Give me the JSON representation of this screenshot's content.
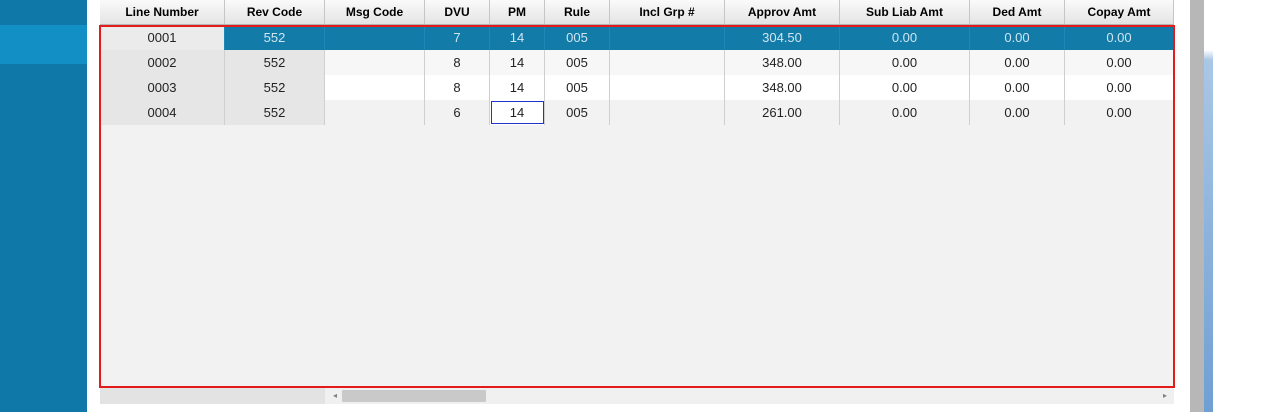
{
  "grid": {
    "columns": [
      "Line Number",
      "Rev Code",
      "Msg Code",
      "DVU",
      "PM",
      "Rule",
      "Incl Grp #",
      "Approv Amt",
      "Sub Liab Amt",
      "Ded Amt",
      "Copay Amt"
    ],
    "rows": [
      {
        "line": "0001",
        "rev": "552",
        "msg": "",
        "dvu": "7",
        "pm": "14",
        "rule": "005",
        "incl": "",
        "approv": "304.50",
        "subliab": "0.00",
        "ded": "0.00",
        "copay": "0.00"
      },
      {
        "line": "0002",
        "rev": "552",
        "msg": "",
        "dvu": "8",
        "pm": "14",
        "rule": "005",
        "incl": "",
        "approv": "348.00",
        "subliab": "0.00",
        "ded": "0.00",
        "copay": "0.00"
      },
      {
        "line": "0003",
        "rev": "552",
        "msg": "",
        "dvu": "8",
        "pm": "14",
        "rule": "005",
        "incl": "",
        "approv": "348.00",
        "subliab": "0.00",
        "ded": "0.00",
        "copay": "0.00"
      },
      {
        "line": "0004",
        "rev": "552",
        "msg": "",
        "dvu": "6",
        "pm": "14",
        "rule": "005",
        "incl": "",
        "approv": "261.00",
        "subliab": "0.00",
        "ded": "0.00",
        "copay": "0.00"
      }
    ]
  },
  "scrollbar": {
    "left_arrow": "◂",
    "right_arrow": "▸"
  },
  "colors": {
    "nav": "#0f78a8",
    "nav_selected": "#128fc4",
    "row_selected": "#127ba8",
    "outline": "#e41b1b",
    "focus": "#2233cc"
  }
}
